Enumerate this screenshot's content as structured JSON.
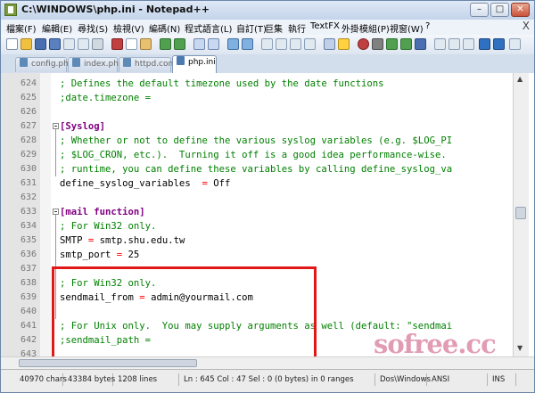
{
  "window": {
    "title": "C:\\WINDOWS\\php.ini - Notepad++",
    "minimize": "–",
    "maximize": "□",
    "close": "✕"
  },
  "menu": {
    "items": [
      "檔案(F)",
      "編輯(E)",
      "尋找(S)",
      "檢視(V)",
      "編碼(N)",
      "程式語言(L)",
      "自訂(T)",
      "巨集",
      "執行",
      "TextFX",
      "外掛模組(P)",
      "視窗(W)",
      "?"
    ],
    "close": "X"
  },
  "tabs": [
    {
      "label": "config.php",
      "active": false
    },
    {
      "label": "index.php",
      "active": false
    },
    {
      "label": "httpd.conf",
      "active": false
    },
    {
      "label": "php.ini",
      "active": true
    }
  ],
  "editor": {
    "lines": [
      {
        "num": "624",
        "text": "; Defines the default timezone used by the date functions",
        "style": "comment"
      },
      {
        "num": "625",
        "text": ";date.timezone =",
        "style": "comment"
      },
      {
        "num": "626",
        "text": "",
        "style": "plain"
      },
      {
        "num": "627",
        "text": "[Syslog]",
        "style": "section",
        "fold": true
      },
      {
        "num": "628",
        "text": "; Whether or not to define the various syslog variables (e.g. $LOG_PI",
        "style": "comment"
      },
      {
        "num": "629",
        "text": "; $LOG_CRON, etc.).  Turning it off is a good idea performance-wise.",
        "style": "comment"
      },
      {
        "num": "630",
        "text": "; runtime, you can define these variables by calling define_syslog_va",
        "style": "comment"
      },
      {
        "num": "631",
        "key": "define_syslog_variables",
        "op": "  =",
        "val": " Off",
        "style": "kv"
      },
      {
        "num": "632",
        "text": "",
        "style": "plain"
      },
      {
        "num": "633",
        "text": "[mail function]",
        "style": "section",
        "fold": true
      },
      {
        "num": "634",
        "text": "; For Win32 only.",
        "style": "comment"
      },
      {
        "num": "635",
        "key": "SMTP",
        "op": " =",
        "val": " smtp.shu.edu.tw",
        "style": "kv"
      },
      {
        "num": "636",
        "key": "smtp_port",
        "op": " =",
        "val": " 25",
        "style": "kv"
      },
      {
        "num": "637",
        "text": "",
        "style": "plain"
      },
      {
        "num": "638",
        "text": "; For Win32 only.",
        "style": "comment"
      },
      {
        "num": "639",
        "key": "sendmail_from",
        "op": " =",
        "val": " admin@yourmail.com",
        "style": "kv"
      },
      {
        "num": "640",
        "text": "",
        "style": "plain"
      },
      {
        "num": "641",
        "text": "; For Unix only.  You may supply arguments as well (default: \"sendmai",
        "style": "comment"
      },
      {
        "num": "642",
        "text": ";sendmail_path =",
        "style": "comment"
      },
      {
        "num": "643",
        "text": "",
        "style": "plain"
      }
    ]
  },
  "status": {
    "chars": "40970 chars",
    "bytes": "43384 bytes",
    "lines": "1208 lines",
    "position": "Ln : 645   Col : 47   Sel : 0 (0 bytes) in 0 ranges",
    "eol": "Dos\\Windows",
    "encoding": "ANSI",
    "mode": "INS"
  },
  "watermark": "sofree.cc",
  "colors": {
    "comment": "#008000",
    "section": "#800080",
    "operator": "#ff0000",
    "highlight": "#e01818"
  }
}
